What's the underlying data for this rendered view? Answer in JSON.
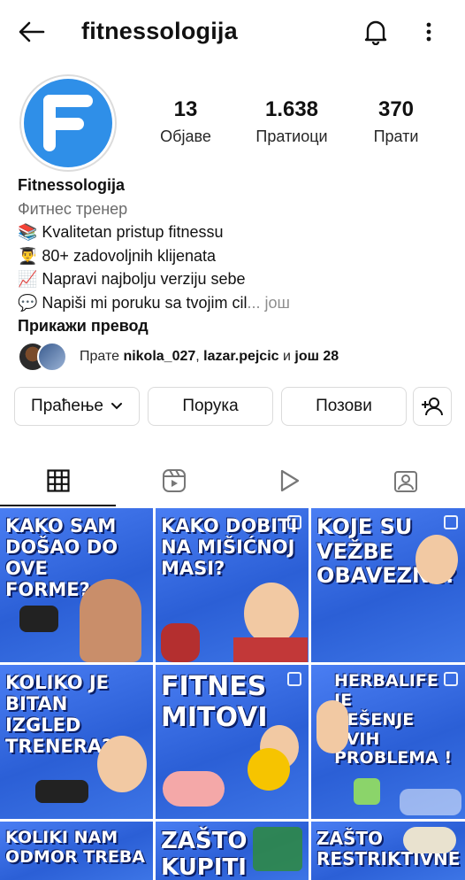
{
  "header": {
    "username": "fitnessologija"
  },
  "stats": {
    "posts_count": "13",
    "posts_label": "Објаве",
    "followers_count": "1.638",
    "followers_label": "Пратиоци",
    "following_count": "370",
    "following_label": "Прати"
  },
  "bio": {
    "name": "Fitnessologija",
    "category": "Фитнес тренер",
    "lines": [
      "📚 Kvalitetan pristup fitnessu",
      "👨‍🎓 80+ zadovoljnih klijenata",
      "📈 Napravi najbolju verziju sebe",
      "💬  Napiši mi poruku sa tvojim cil"
    ],
    "ellipsis": "...",
    "more": "још",
    "translate": "Прикажи превод"
  },
  "followed_by": {
    "prefix": "Прате ",
    "user1": "nikola_027",
    "sep": ", ",
    "user2": "lazar.pejcic",
    "and": " и ",
    "others": "још 28"
  },
  "actions": {
    "following": "Праћење",
    "message": "Порука",
    "call": "Позови"
  },
  "tabs": [
    "grid",
    "reels",
    "videos",
    "tagged"
  ],
  "posts": [
    {
      "caption": "KAKO SAM\nDOŠAO DO OVE\nFORME?"
    },
    {
      "caption": "KAKO DOBITI\nNA MIŠIĆNOJ\nMASI?"
    },
    {
      "caption": "KOJE SU\nVEŽBE\nOBAVEZNE?"
    },
    {
      "caption": "KOLIKO JE\nBITAN IZGLED\nTRENERA?"
    },
    {
      "caption": "FITNES\nMITOVI"
    },
    {
      "caption": "HERBALIFE JE\nREŠENJE SVIH\nPROBLEMA !"
    },
    {
      "caption": "KOLIKI NAM\nODMOR TREBA"
    },
    {
      "caption": "ZAŠTO\nKUPITI"
    },
    {
      "caption": "ZAŠTO\nRESTRIKTIVNE"
    }
  ],
  "colors": {
    "brand_blue": "#2f8fe8",
    "tile_blue": "#3d75e6"
  }
}
